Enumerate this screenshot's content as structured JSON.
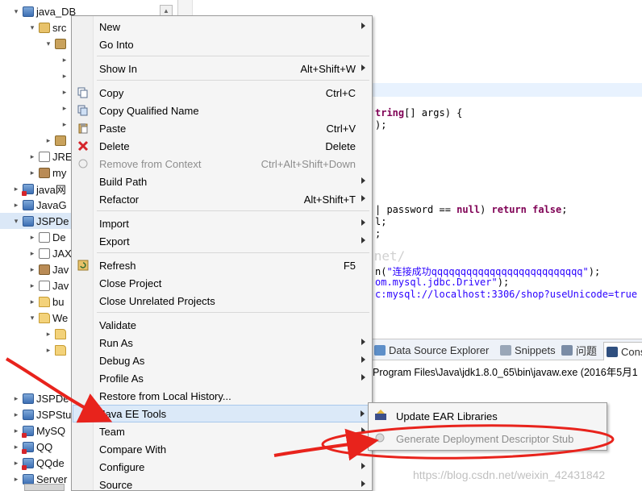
{
  "explorer": {
    "rows": [
      {
        "label": "java_DB",
        "twisty": "▾",
        "icon": "project",
        "indent": 0
      },
      {
        "label": "src",
        "twisty": "▾",
        "icon": "src",
        "indent": 1
      },
      {
        "label": "",
        "twisty": "▾",
        "icon": "package",
        "indent": 2
      },
      {
        "label": "",
        "twisty": "▸",
        "icon": "file",
        "indent": 3
      },
      {
        "label": "",
        "twisty": "▸",
        "icon": "file",
        "indent": 3
      },
      {
        "label": "",
        "twisty": "▸",
        "icon": "file",
        "indent": 3
      },
      {
        "label": "",
        "twisty": "▸",
        "icon": "file",
        "indent": 3
      },
      {
        "label": "",
        "twisty": "▸",
        "icon": "file",
        "indent": 3
      },
      {
        "label": "",
        "twisty": "▸",
        "icon": "package",
        "indent": 2
      },
      {
        "label": "JRE",
        "twisty": "▸",
        "icon": "library",
        "indent": 1
      },
      {
        "label": "my",
        "twisty": "▸",
        "icon": "jar",
        "indent": 1
      },
      {
        "label": "java网",
        "twisty": "▸",
        "icon": "project-error",
        "indent": 0
      },
      {
        "label": "JavaG",
        "twisty": "▸",
        "icon": "project",
        "indent": 0
      },
      {
        "label": "JSPDe",
        "twisty": "▾",
        "icon": "project",
        "indent": 0,
        "selected": true
      },
      {
        "label": "De",
        "twisty": "▸",
        "icon": "library",
        "indent": 1
      },
      {
        "label": "JAX",
        "twisty": "▸",
        "icon": "library",
        "indent": 1
      },
      {
        "label": "Jav",
        "twisty": "▸",
        "icon": "jar",
        "indent": 1
      },
      {
        "label": "Jav",
        "twisty": "▸",
        "icon": "library",
        "indent": 1
      },
      {
        "label": "bu",
        "twisty": "▸",
        "icon": "folder",
        "indent": 1
      },
      {
        "label": "We",
        "twisty": "▾",
        "icon": "folder",
        "indent": 1
      },
      {
        "label": "",
        "twisty": "▸",
        "icon": "folder",
        "indent": 2
      },
      {
        "label": "",
        "twisty": "▸",
        "icon": "folder",
        "indent": 2
      },
      {
        "label": "",
        "twisty": "",
        "icon": "",
        "indent": 0
      },
      {
        "label": "",
        "twisty": "",
        "icon": "",
        "indent": 0
      },
      {
        "label": "JSPDe",
        "twisty": "▸",
        "icon": "project",
        "indent": 0
      },
      {
        "label": "JSPStu",
        "twisty": "▸",
        "icon": "project",
        "indent": 0
      },
      {
        "label": "MySQ",
        "twisty": "▸",
        "icon": "project-error",
        "indent": 0
      },
      {
        "label": "QQ",
        "twisty": "▸",
        "icon": "project-error",
        "indent": 0
      },
      {
        "label": "QQde",
        "twisty": "▸",
        "icon": "project-error",
        "indent": 0
      },
      {
        "label": "Server",
        "twisty": "▸",
        "icon": "project",
        "indent": 0
      }
    ]
  },
  "editor": {
    "lines": [
      {
        "html": "<span class='kw'>tring</span>[] args) {",
        "row": 0
      },
      {
        "html": ");",
        "row": 1
      },
      {
        "html": "| password == <span class='kw'>null</span>) <span class='kw'>return false</span>;",
        "row": 2
      },
      {
        "html": "l;",
        "row": 3
      },
      {
        "html": ";",
        "row": 4
      },
      {
        "html": "n(<span class='str'>\"连接成功qqqqqqqqqqqqqqqqqqqqqqqqqq\"</span>);",
        "row": 5
      },
      {
        "html": "<span class='str'>om.mysql.jdbc.Driver\"</span>);",
        "row": 6
      },
      {
        "html": "<span class='str'>c:mysql://localhost:3306/shop?useUnicode=true &amp;</span>",
        "row": 7
      }
    ]
  },
  "console": {
    "tabs": [
      {
        "label": "Data Source Explorer",
        "color": "#5d8fc9"
      },
      {
        "label": "Snippets",
        "color": "#9aa7b8"
      },
      {
        "label": "问题",
        "color": "#7a8ca6"
      },
      {
        "label": "Cons",
        "color": "#2f4f7f",
        "active": true
      }
    ],
    "output": "Program Files\\Java\\jdk1.8.0_65\\bin\\javaw.exe (2016年5月1"
  },
  "context_menu": {
    "items": [
      {
        "label": "New",
        "shortcut": "",
        "submenu": true,
        "icon": "",
        "name": "menu-item-new"
      },
      {
        "label": "Go Into",
        "shortcut": "",
        "submenu": false,
        "icon": "",
        "name": "menu-item-go-into"
      },
      {
        "sep": true
      },
      {
        "label": "Show In",
        "shortcut": "Alt+Shift+W",
        "submenu": true,
        "icon": "",
        "name": "menu-item-show-in"
      },
      {
        "sep": true
      },
      {
        "label": "Copy",
        "shortcut": "Ctrl+C",
        "submenu": false,
        "icon": "copy",
        "name": "menu-item-copy"
      },
      {
        "label": "Copy Qualified Name",
        "shortcut": "",
        "submenu": false,
        "icon": "copy-qualified",
        "name": "menu-item-copy-qualified-name"
      },
      {
        "label": "Paste",
        "shortcut": "Ctrl+V",
        "submenu": false,
        "icon": "paste",
        "name": "menu-item-paste"
      },
      {
        "label": "Delete",
        "shortcut": "Delete",
        "submenu": false,
        "icon": "delete",
        "name": "menu-item-delete"
      },
      {
        "label": "Remove from Context",
        "shortcut": "Ctrl+Alt+Shift+Down",
        "submenu": false,
        "icon": "remove-context",
        "disabled": true,
        "name": "menu-item-remove-from-context"
      },
      {
        "label": "Build Path",
        "shortcut": "",
        "submenu": true,
        "icon": "",
        "name": "menu-item-build-path"
      },
      {
        "label": "Refactor",
        "shortcut": "Alt+Shift+T",
        "submenu": true,
        "icon": "",
        "name": "menu-item-refactor"
      },
      {
        "sep": true
      },
      {
        "label": "Import",
        "shortcut": "",
        "submenu": true,
        "icon": "",
        "name": "menu-item-import"
      },
      {
        "label": "Export",
        "shortcut": "",
        "submenu": true,
        "icon": "",
        "name": "menu-item-export"
      },
      {
        "sep": true
      },
      {
        "label": "Refresh",
        "shortcut": "F5",
        "submenu": false,
        "icon": "refresh",
        "name": "menu-item-refresh"
      },
      {
        "label": "Close Project",
        "shortcut": "",
        "submenu": false,
        "icon": "",
        "name": "menu-item-close-project"
      },
      {
        "label": "Close Unrelated Projects",
        "shortcut": "",
        "submenu": false,
        "icon": "",
        "name": "menu-item-close-unrelated-projects"
      },
      {
        "sep": true
      },
      {
        "label": "Validate",
        "shortcut": "",
        "submenu": false,
        "icon": "",
        "name": "menu-item-validate"
      },
      {
        "label": "Run As",
        "shortcut": "",
        "submenu": true,
        "icon": "",
        "name": "menu-item-run-as"
      },
      {
        "label": "Debug As",
        "shortcut": "",
        "submenu": true,
        "icon": "",
        "name": "menu-item-debug-as"
      },
      {
        "label": "Profile As",
        "shortcut": "",
        "submenu": true,
        "icon": "",
        "name": "menu-item-profile-as"
      },
      {
        "label": "Restore from Local History...",
        "shortcut": "",
        "submenu": false,
        "icon": "",
        "name": "menu-item-restore-from-local-history"
      },
      {
        "label": "Java EE Tools",
        "shortcut": "",
        "submenu": true,
        "icon": "",
        "active": true,
        "name": "menu-item-java-ee-tools"
      },
      {
        "label": "Team",
        "shortcut": "",
        "submenu": true,
        "icon": "",
        "name": "menu-item-team"
      },
      {
        "label": "Compare With",
        "shortcut": "",
        "submenu": true,
        "icon": "",
        "name": "menu-item-compare-with"
      },
      {
        "label": "Configure",
        "shortcut": "",
        "submenu": true,
        "icon": "",
        "name": "menu-item-configure"
      },
      {
        "label": "Source",
        "shortcut": "",
        "submenu": true,
        "icon": "",
        "name": "menu-item-source"
      }
    ]
  },
  "submenu": {
    "items": [
      {
        "label": "Update EAR Libraries",
        "icon": "update-ear",
        "name": "submenu-item-update-ear-libraries"
      },
      {
        "label": "Generate Deployment Descriptor Stub",
        "icon": "generate-descriptor",
        "disabled": true,
        "name": "submenu-item-generate-deployment-descriptor-stub"
      }
    ]
  },
  "watermarks": {
    "top": "http://blog.csdn.net/",
    "bottom": "https://blog.csdn.net/weixin_42431842"
  },
  "colors": {
    "annotation_red": "#e8231c",
    "selection_blue": "#dbe9f8"
  }
}
